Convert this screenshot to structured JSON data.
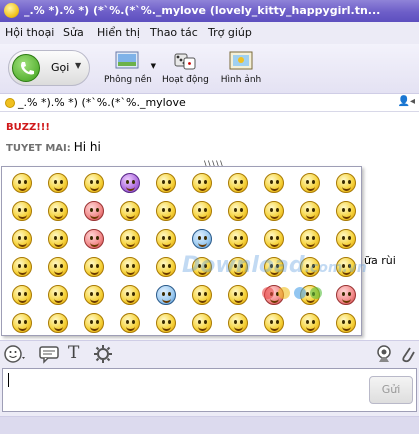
{
  "window": {
    "title": "_.% *).% *) (*`%.(*`%._mylove (lovely_kitty_happygirl.tn..."
  },
  "menu": [
    "Hội thoại",
    "Sửa",
    "Hiển thị",
    "Thao tác",
    "Trợ giúp"
  ],
  "toolbar": {
    "call_label": "Gọi",
    "items": [
      {
        "label": "Phông nền",
        "icon": "background-icon"
      },
      {
        "label": "Hoạt động",
        "icon": "activity-icon"
      },
      {
        "label": "Hình ảnh",
        "icon": "photo-icon"
      }
    ]
  },
  "contact": {
    "status_name": "_.% *).% *) (*`%.(*`%._mylove"
  },
  "chat": {
    "buzz": "BUZZ!!!",
    "sender": "TUYET MAI:",
    "message": "Hi hi",
    "ellipsis": "\\\\\\\\\\",
    "tail": "ữa rùi"
  },
  "emoticons": {
    "count": 60,
    "colors": [
      "#f6d23a",
      "#f28a8a",
      "#b070e0",
      "#9ccaf0"
    ]
  },
  "watermark": {
    "text": "Download",
    "sub": ".com.vn"
  },
  "input": {
    "value": "",
    "send_label": "Gửi"
  },
  "colors": {
    "title_bar": "#6d5ec8",
    "buzz": "#d0181a",
    "accent": "#5d4fbf"
  }
}
